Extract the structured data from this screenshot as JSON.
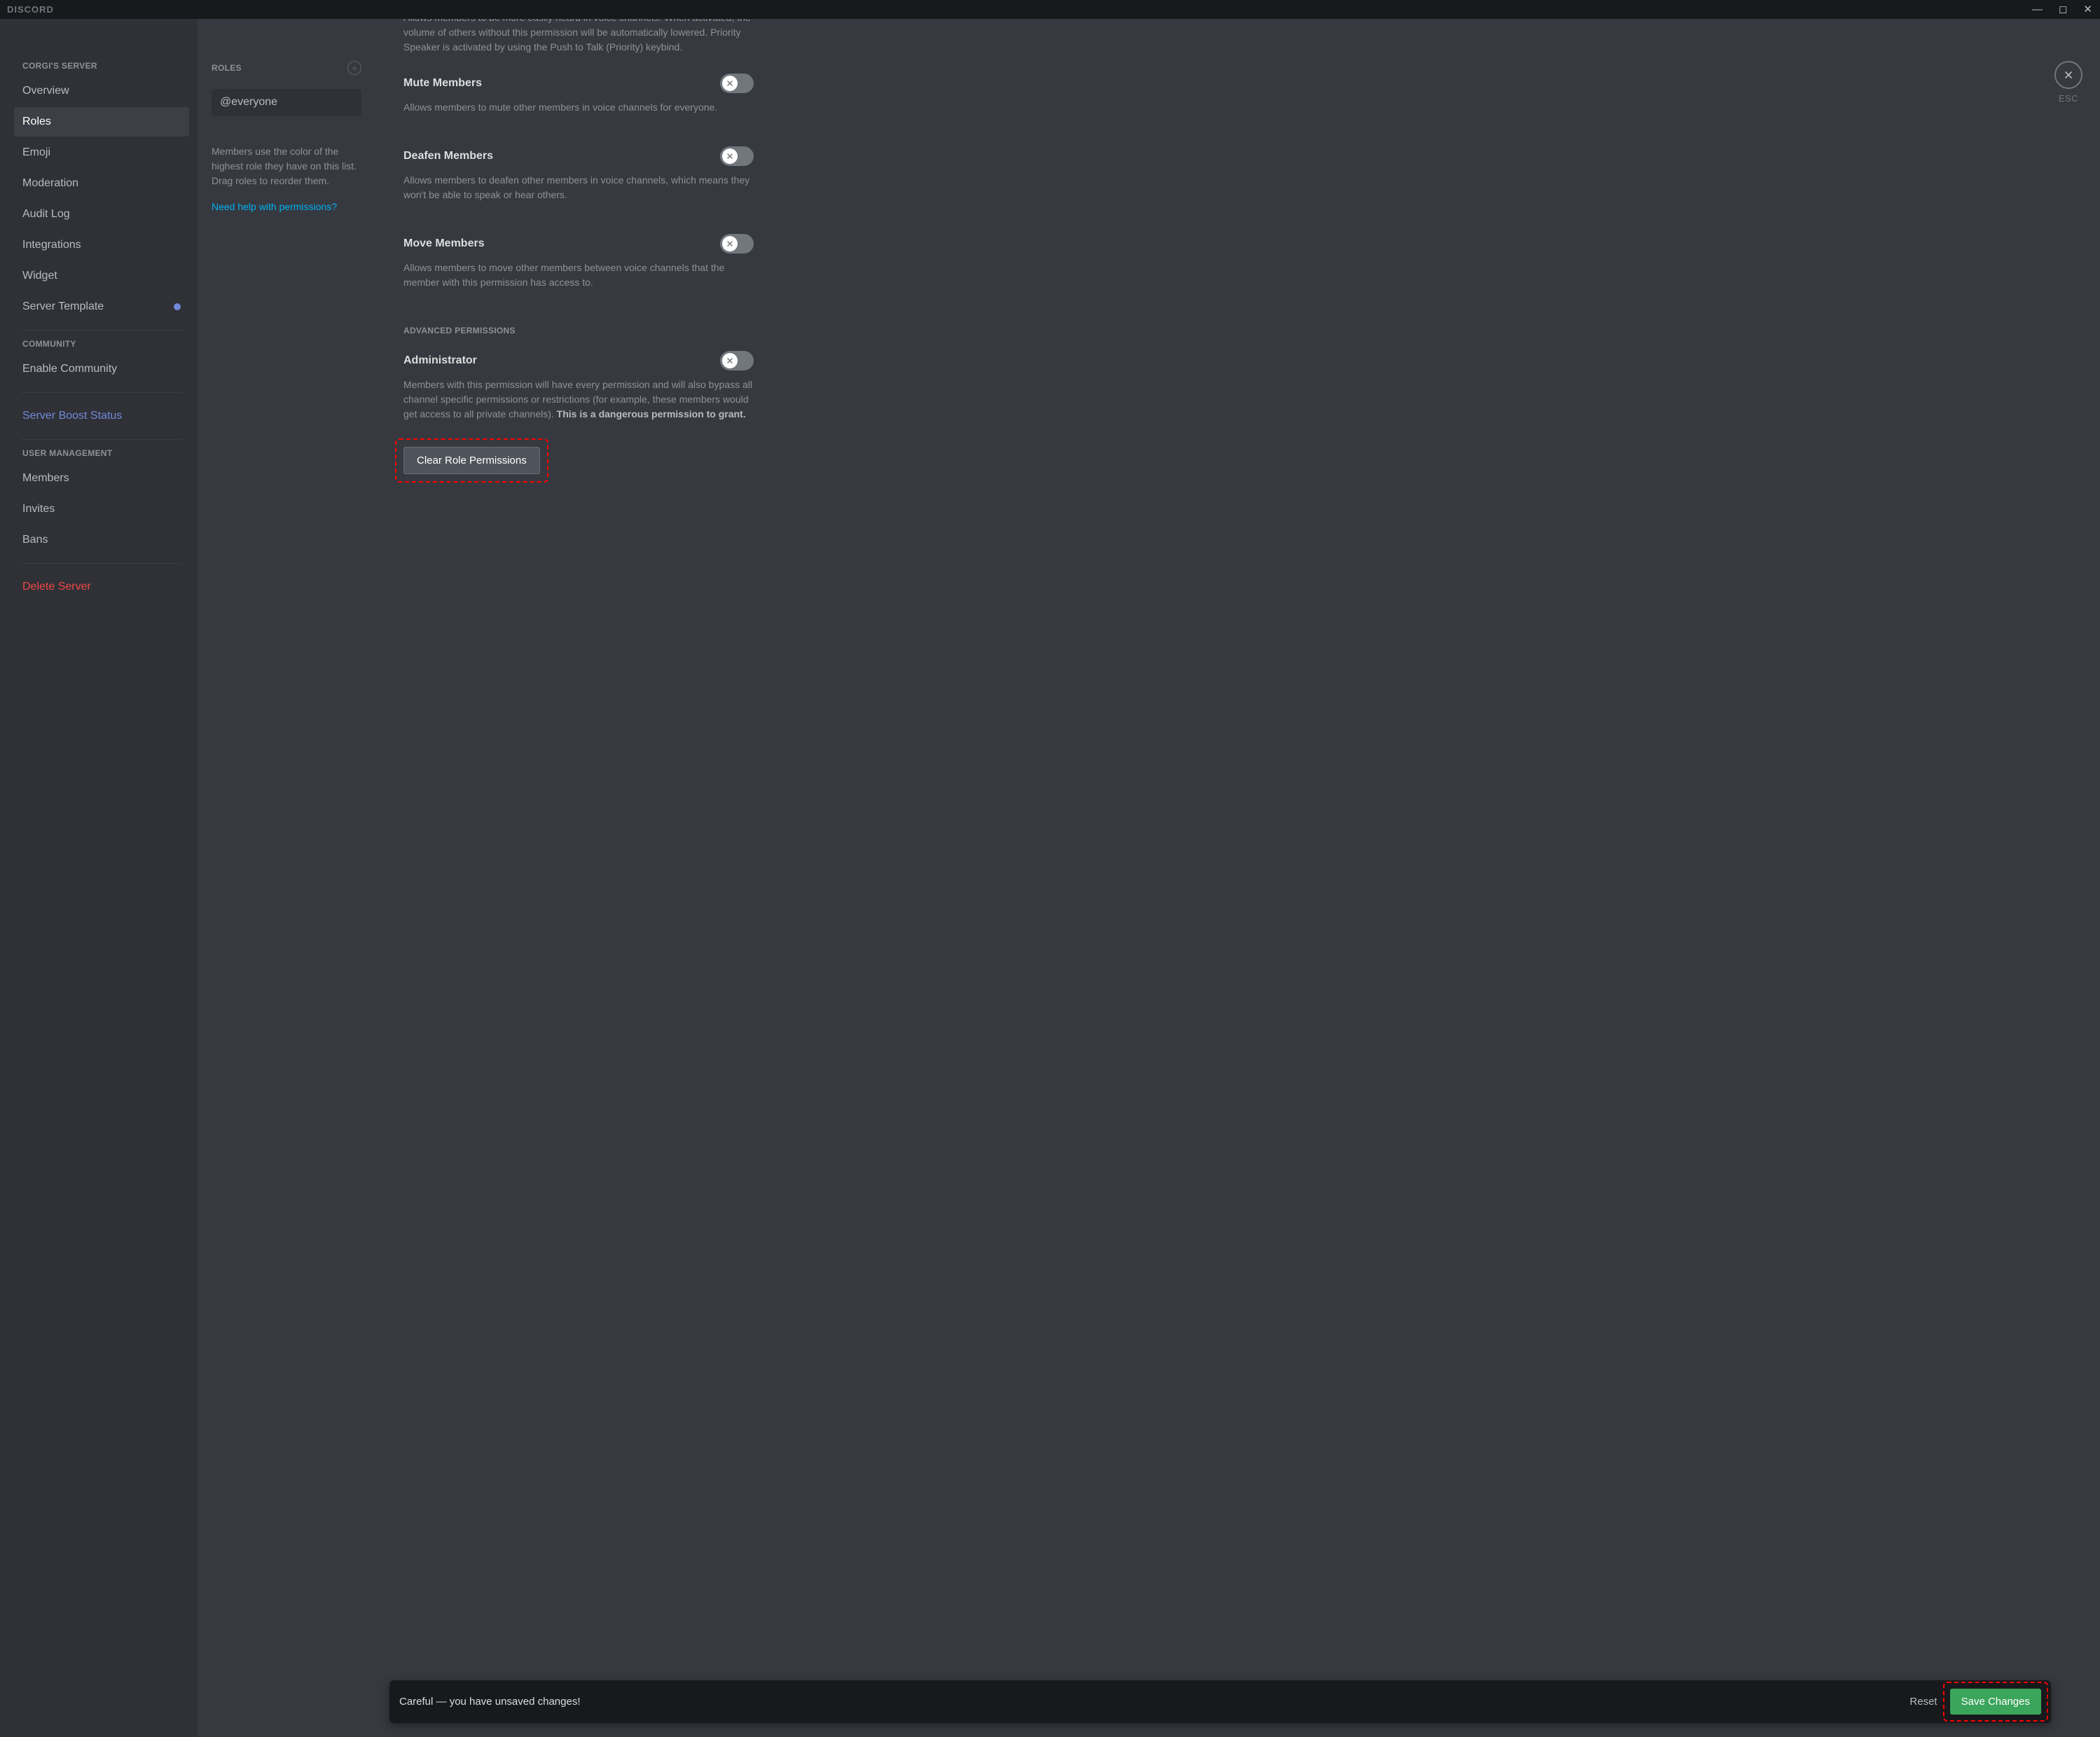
{
  "brand": "DISCORD",
  "close_label": "ESC",
  "sidebar": {
    "server_header": "CORGI'S SERVER",
    "items": [
      {
        "label": "Overview"
      },
      {
        "label": "Roles"
      },
      {
        "label": "Emoji"
      },
      {
        "label": "Moderation"
      },
      {
        "label": "Audit Log"
      },
      {
        "label": "Integrations"
      },
      {
        "label": "Widget"
      },
      {
        "label": "Server Template"
      }
    ],
    "community_header": "COMMUNITY",
    "community_item": "Enable Community",
    "boost_item": "Server Boost Status",
    "user_header": "USER MANAGEMENT",
    "user_items": [
      {
        "label": "Members"
      },
      {
        "label": "Invites"
      },
      {
        "label": "Bans"
      }
    ],
    "delete_item": "Delete Server"
  },
  "roles": {
    "header": "ROLES",
    "everyone": "@everyone",
    "hint": "Members use the color of the highest role they have on this list. Drag roles to reorder them.",
    "help_link": "Need help with permissions?"
  },
  "permissions": {
    "priority_desc_prefix": "Allows members to be more easily heard in voice channels. When activated, the volume of others without this permission will be automatically lowered. Priority Speaker is activated by using the ",
    "priority_link": "Push to Talk (Priority)",
    "priority_desc_suffix": " keybind.",
    "items": [
      {
        "title": "Mute Members",
        "desc": "Allows members to mute other members in voice channels for everyone."
      },
      {
        "title": "Deafen Members",
        "desc": "Allows members to deafen other members in voice channels, which means they won't be able to speak or hear others."
      },
      {
        "title": "Move Members",
        "desc": "Allows members to move other members between voice channels that the member with this permission has access to."
      }
    ],
    "advanced_header": "ADVANCED PERMISSIONS",
    "admin": {
      "title": "Administrator",
      "desc": "Members with this permission will have every permission and will also bypass all channel specific permissions or restrictions (for example, these members would get access to all private channels). ",
      "desc_strong": "This is a dangerous permission to grant."
    },
    "clear_button": "Clear Role Permissions"
  },
  "unsaved": {
    "message": "Careful — you have unsaved changes!",
    "reset": "Reset",
    "save": "Save Changes"
  }
}
